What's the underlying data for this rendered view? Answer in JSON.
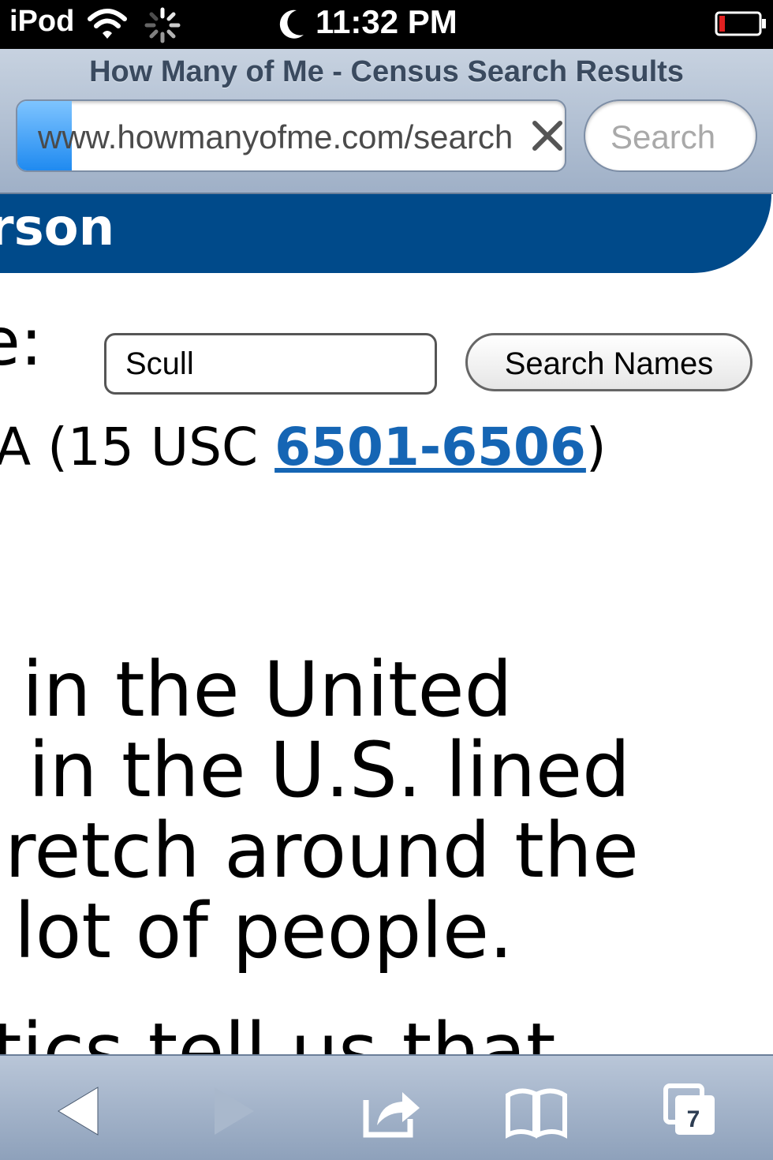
{
  "status_bar": {
    "carrier": "iPod",
    "time": "11:32 PM"
  },
  "browser": {
    "page_title": "How Many of Me - Census Search Results",
    "url": "www.howmanyofme.com/search",
    "search_placeholder": "Search",
    "progress_fraction": 0.1,
    "tab_count": "7"
  },
  "page": {
    "banner_text": "rson",
    "name_label": "e:",
    "name_input_value": "Scull",
    "search_button_label": "Search Names",
    "law_prefix": "A (15 USC ",
    "law_link": "6501-6506",
    "law_suffix": ")",
    "paragraph_lines": [
      "in the United",
      "in the U.S. lined",
      "retch around the",
      "lot of people.",
      "tics tell us that"
    ]
  },
  "colors": {
    "banner": "#004a8a",
    "link": "#1565b4",
    "progress": "#1f8af0"
  },
  "icons": {
    "back": "triangle-left-icon",
    "forward": "triangle-right-icon",
    "share": "share-arrow-icon",
    "bookmarks": "open-book-icon",
    "tabs": "pages-icon"
  }
}
